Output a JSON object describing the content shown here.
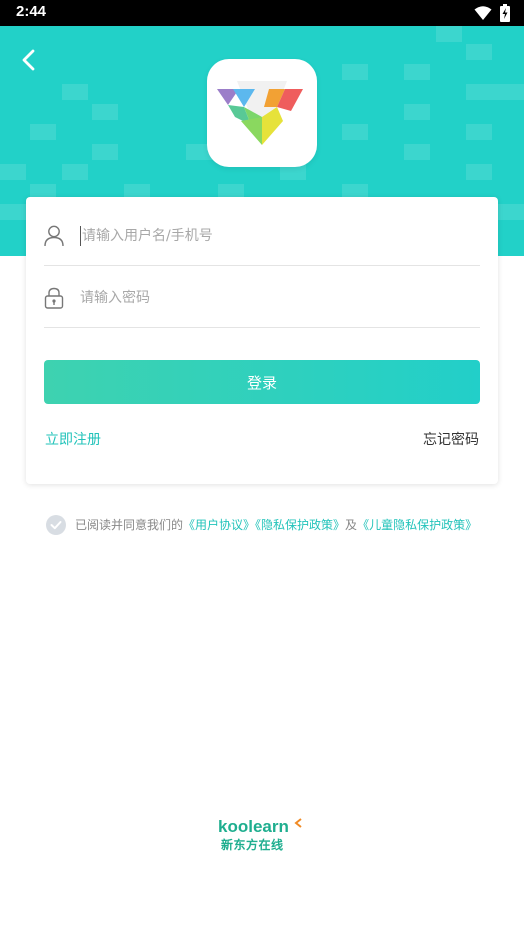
{
  "status_bar": {
    "time": "2:44"
  },
  "icons": {
    "back": "chevron-left-icon",
    "user": "user-icon",
    "lock": "lock-icon",
    "check": "check-icon",
    "wifi": "wifi-icon",
    "battery": "battery-icon"
  },
  "colors": {
    "header": "#22d1c8",
    "accent": "#22c3ba",
    "button_start": "#3ed2b0",
    "button_end": "#22cfc9",
    "brand": "#1fae8f"
  },
  "login": {
    "username_placeholder": "请输入用户名/手机号",
    "password_placeholder": "请输入密码",
    "submit_label": "登录",
    "register_label": "立即注册",
    "forgot_label": "忘记密码"
  },
  "agreement": {
    "prefix": "已阅读并同意我们的",
    "user_agreement": "《用户协议》",
    "privacy_policy": "《隐私保护政策》",
    "conjunction": "及",
    "child_privacy": "《儿童隐私保护政策》"
  },
  "brand": {
    "english": "koolearn",
    "chinese": "新东方在线"
  }
}
